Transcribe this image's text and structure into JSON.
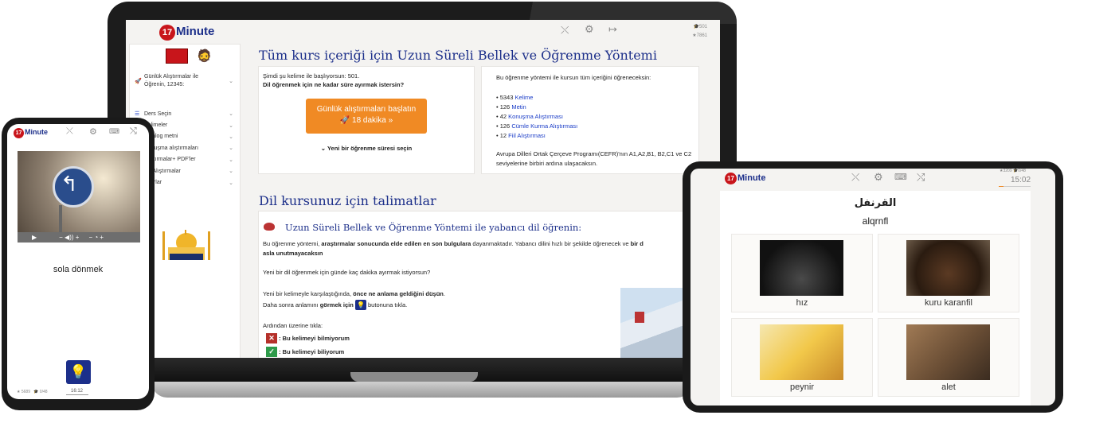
{
  "logo": {
    "number": "17",
    "text": "Minute"
  },
  "laptop": {
    "stats": {
      "hats": "501",
      "stars": "7861"
    },
    "sidebar": {
      "daily": "Günlük Alıştırmalar ile Öğrenin, 12345:",
      "items": [
        "Ders Seçin",
        "Kelimeler",
        "Diyalog metni",
        "Konuşma alıştırmaları",
        "Alıştırmalar+ PDF'ler",
        "Fiil Alıştırmalar",
        "Ayarlar"
      ]
    },
    "title1": "Tüm kurs içeriği için Uzun Süreli Bellek ve Öğrenme Yöntemi",
    "card_left": {
      "line1": "Şimdi şu kelime ile başlıyorsun: 501.",
      "line2": "Dil öğrenmek için ne kadar süre ayırmak istersin?",
      "btn_line1": "Günlük alıştırmaları başlatın",
      "btn_line2": "🚀 18 dakika »",
      "choose": "⌄ Yeni bir öğrenme süresi seçin"
    },
    "card_right": {
      "intro": "Bu öğrenme yöntemi ile kursun tüm içeriğini öğreneceksin:",
      "items": [
        {
          "num": "5343",
          "label": "Kelime"
        },
        {
          "num": "126",
          "label": "Metin"
        },
        {
          "num": "42",
          "label": "Konuşma Alıştırması"
        },
        {
          "num": "126",
          "label": "Cümle Kurma Alıştırması"
        },
        {
          "num": "12",
          "label": "Fiil Alıştırması"
        }
      ],
      "cefr": "Avrupa Dilleri Ortak Çerçeve Programı(CEFR)'nın A1,A2,B1, B2,C1 ve C2 seviyelerine birbiri ardına ulaşacaksın."
    },
    "title2": "Dil kursunuz için talimatlar",
    "instr": {
      "heading": "Uzun Süreli Bellek ve Öğrenme Yöntemi ile yabancı dil öğrenin:",
      "p1_a": "Bu öğrenme yöntemi, ",
      "p1_b": "araştırmalar sonucunda elde edilen en son bulgulara",
      "p1_c": " dayanmaktadır. Yabancı dilini hızlı bir şekilde öğrenecek ve ",
      "p1_d": "bir d",
      "p1_e": "asla unutmayacaksın",
      "p2": "Yeni bir dil öğrenmek için günde kaç dakika ayırmak istiyorsun?",
      "p3_a": "Yeni bir kelimeyle karşılaştığında, ",
      "p3_b": "önce ne anlama geldiğini düşün",
      "p3_c": ".",
      "p4_a": "Daha sonra anlamını ",
      "p4_b": "görmek için",
      "p4_c": " butonuna tıkla.",
      "p5": "Ardından üzerine tıkla:",
      "no": ": Bu kelimeyi bilmiyorum",
      "yes": ": Bu kelimeyi biliyorum"
    }
  },
  "phone": {
    "word": "sola dönmek",
    "stats": {
      "stars": "5689",
      "hats": "0/48",
      "time": "16:12"
    }
  },
  "tablet": {
    "stats": {
      "stars": "3209",
      "hats": "0/48",
      "time": "15:02"
    },
    "arabic": "القرنفل",
    "translit": "alqrnfl",
    "options": [
      "hız",
      "kuru karanfil",
      "peynir",
      "alet"
    ]
  }
}
